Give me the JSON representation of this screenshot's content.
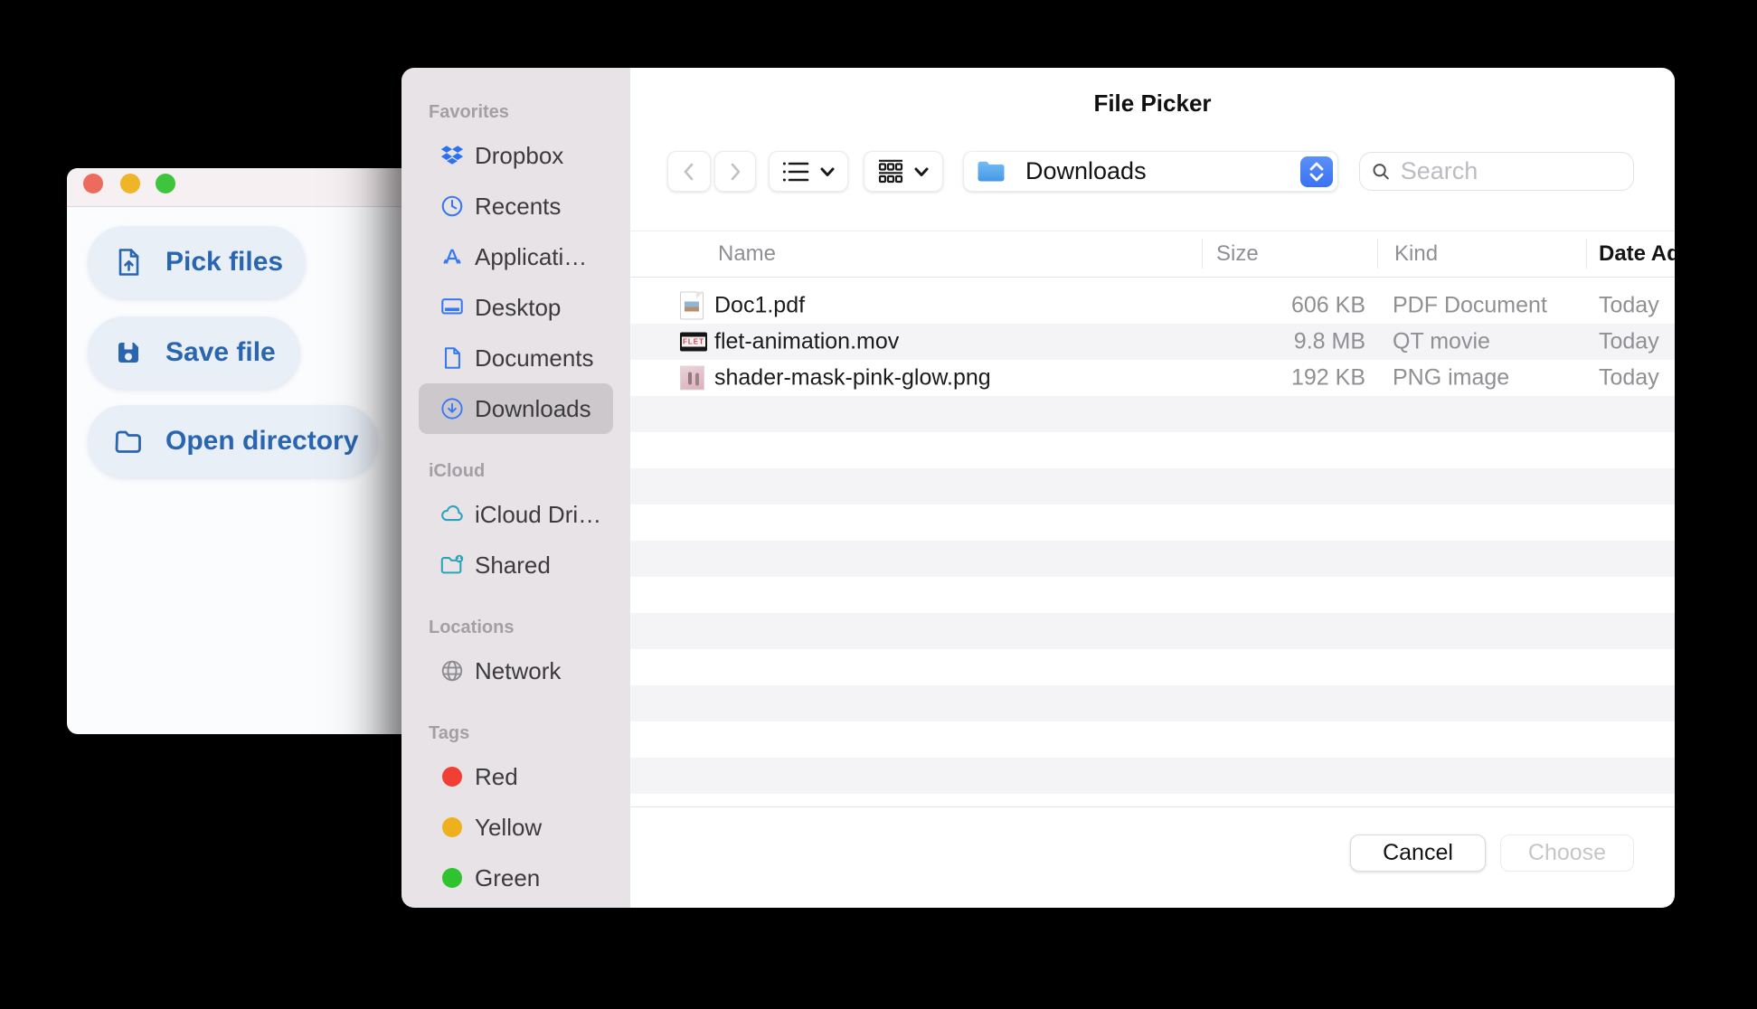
{
  "app_window": {
    "traffic_lights": [
      "close",
      "minimize",
      "zoom"
    ],
    "buttons": [
      {
        "label": "Pick files",
        "icon": "file-upload-icon"
      },
      {
        "label": "Save file",
        "icon": "save-icon"
      },
      {
        "label": "Open directory",
        "icon": "folder-icon"
      }
    ]
  },
  "dialog": {
    "title": "File Picker",
    "sidebar": {
      "sections": [
        {
          "label": "Favorites",
          "items": [
            {
              "label": "Dropbox",
              "icon": "dropbox-icon"
            },
            {
              "label": "Recents",
              "icon": "clock-icon"
            },
            {
              "label": "Applicati…",
              "icon": "app-store-icon"
            },
            {
              "label": "Desktop",
              "icon": "desktop-icon"
            },
            {
              "label": "Documents",
              "icon": "document-icon"
            },
            {
              "label": "Downloads",
              "icon": "download-circle-icon",
              "selected": true
            }
          ]
        },
        {
          "label": "iCloud",
          "items": [
            {
              "label": "iCloud Dri…",
              "icon": "cloud-icon"
            },
            {
              "label": "Shared",
              "icon": "shared-folder-icon"
            }
          ]
        },
        {
          "label": "Locations",
          "items": [
            {
              "label": "Network",
              "icon": "globe-icon"
            }
          ]
        },
        {
          "label": "Tags",
          "items": [
            {
              "label": "Red",
              "icon": "tag-dot",
              "color": "#f23f33"
            },
            {
              "label": "Yellow",
              "icon": "tag-dot",
              "color": "#eeb01c"
            },
            {
              "label": "Green",
              "icon": "tag-dot",
              "color": "#2fc32f"
            }
          ]
        }
      ]
    },
    "toolbar": {
      "location_label": "Downloads",
      "search_placeholder": "Search"
    },
    "table": {
      "columns": {
        "name": "Name",
        "size": "Size",
        "kind": "Kind",
        "date_added": "Date Added"
      },
      "sorted_column": "Date Added",
      "rows": [
        {
          "name": "Doc1.pdf",
          "size": "606 KB",
          "kind": "PDF Document",
          "date_added": "Today",
          "icon": "pdf-file-icon"
        },
        {
          "name": "flet-animation.mov",
          "size": "9.8 MB",
          "kind": "QT movie",
          "date_added": "Today",
          "icon": "movie-file-icon",
          "thumb_text": "FLET"
        },
        {
          "name": "shader-mask-pink-glow.png",
          "size": "192 KB",
          "kind": "PNG image",
          "date_added": "Today",
          "icon": "image-file-icon"
        }
      ]
    },
    "footer": {
      "cancel_label": "Cancel",
      "choose_label": "Choose"
    }
  },
  "colors": {
    "accent_blue": "#3478f6",
    "icloud_teal": "#2aa3bd",
    "button_blue": "#2a66b0",
    "stepper_blue": "#3a72f2",
    "sidebar_bg": "#e8e3e6",
    "traffic_red": "#ed6a5e",
    "traffic_yellow": "#f0b429",
    "traffic_green": "#3fc43e"
  }
}
